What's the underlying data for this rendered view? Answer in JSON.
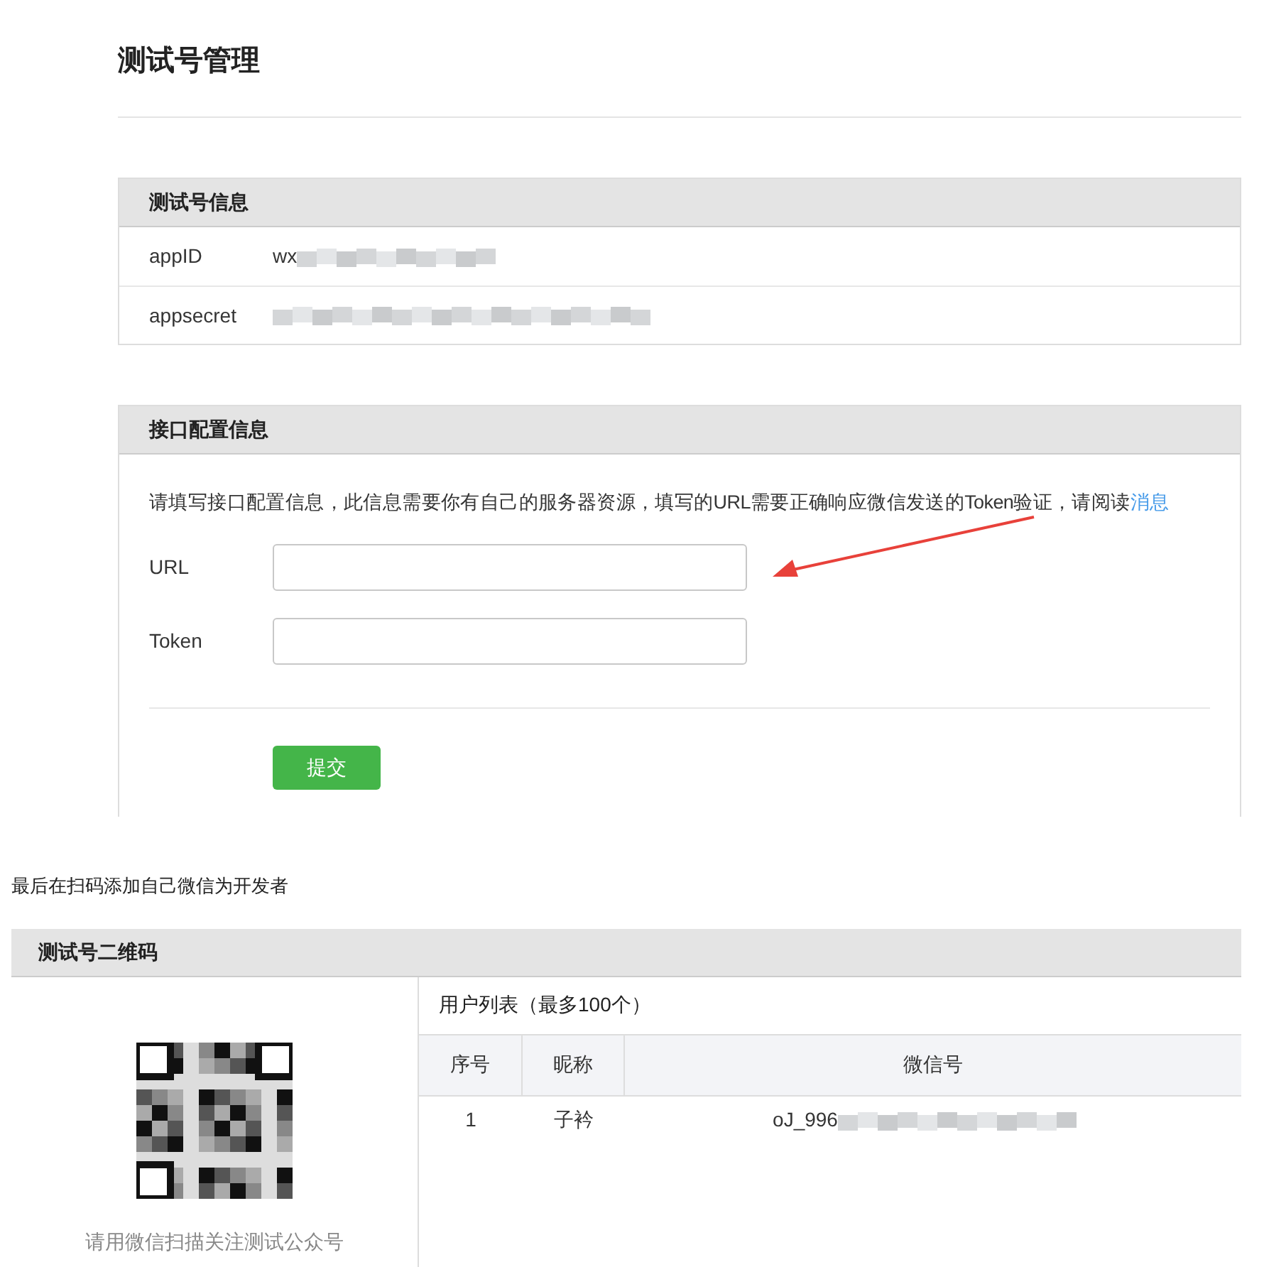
{
  "page_title": "测试号管理",
  "info_panel": {
    "title": "测试号信息",
    "rows": [
      {
        "label": "appID",
        "value": "wx"
      },
      {
        "label": "appsecret",
        "value": ""
      }
    ]
  },
  "config_panel": {
    "title": "接口配置信息",
    "intro": "请填写接口配置信息，此信息需要你有自己的服务器资源，填写的URL需要正确响应微信发送的Token验证，请阅读",
    "intro_link": "消息",
    "fields": [
      {
        "label": "URL"
      },
      {
        "label": "Token"
      }
    ],
    "submit": "提交"
  },
  "caption": "最后在扫码添加自己微信为开发者",
  "qr_panel": {
    "title": "测试号二维码",
    "qr_hint": "请用微信扫描关注测试公众号",
    "user_list_title": "用户列表（最多100个）",
    "columns": [
      "序号",
      "昵称",
      "微信号"
    ],
    "rows": [
      {
        "cells": [
          "1",
          "子衿",
          "oJ_996"
        ]
      }
    ]
  }
}
